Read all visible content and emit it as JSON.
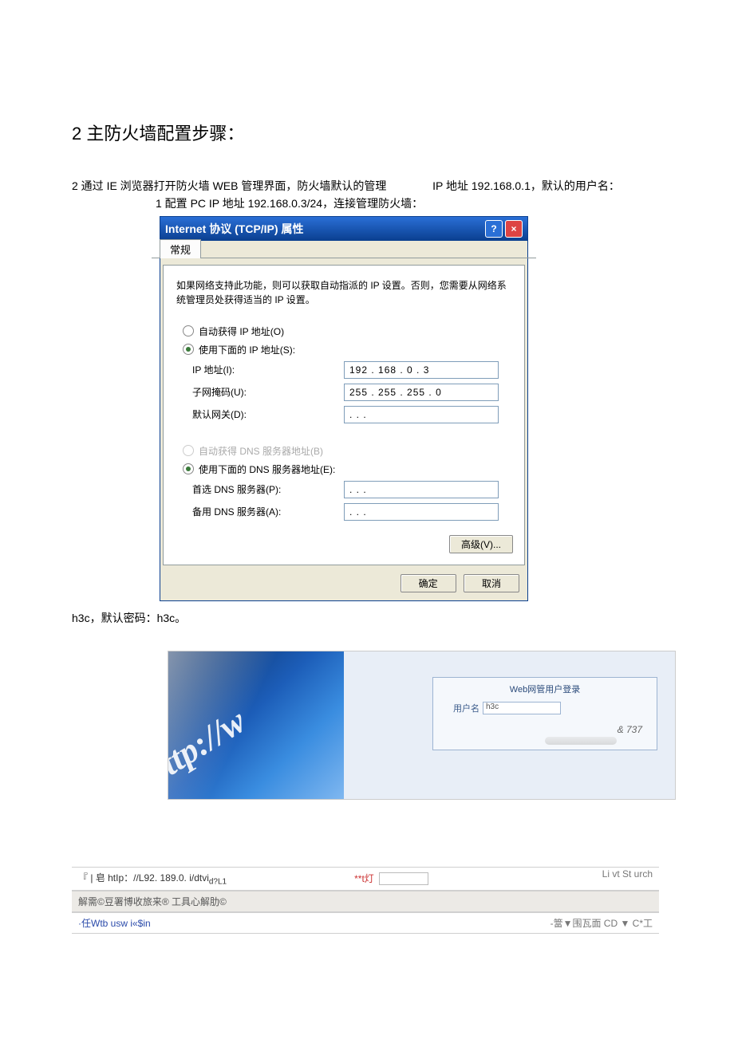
{
  "doc": {
    "heading": "2 主防火墙配置步骤：",
    "para1_left": "2 通过 IE 浏览器打开防火墙 WEB 管理界面，防火墙默认的管理",
    "para1_right": "IP 地址 192.168.0.1，默认的用户名：",
    "para2": "1 配置 PC IP 地址 192.168.0.3/24，连接管理防火墙：",
    "after_dialog": "h3c，默认密码：h3c。"
  },
  "xp": {
    "title": "Internet 协议 (TCP/IP) 属性",
    "tab": "常规",
    "desc": "如果网络支持此功能，则可以获取自动指派的 IP 设置。否则，您需要从网络系统管理员处获得适当的 IP 设置。",
    "radio_auto_ip": "自动获得 IP 地址(O)",
    "radio_manual_ip": "使用下面的 IP 地址(S):",
    "label_ip": "IP 地址(I):",
    "label_mask": "子网掩码(U):",
    "label_gw": "默认网关(D):",
    "radio_auto_dns": "自动获得 DNS 服务器地址(B)",
    "radio_manual_dns": "使用下面的 DNS 服务器地址(E):",
    "label_dns1": "首选 DNS 服务器(P):",
    "label_dns2": "备用 DNS 服务器(A):",
    "ip_value": "192 . 168 .  0  .  3",
    "mask_value": "255 . 255 . 255 .  0",
    "gw_value": " .      .      . ",
    "dns1_value": " .      .      . ",
    "dns2_value": " .      .      . ",
    "btn_adv": "高级(V)...",
    "btn_ok": "确定",
    "btn_cancel": "取消"
  },
  "login": {
    "art_text": "ttp://w",
    "title": "Web网管用户登录",
    "label_user": "用户名",
    "value_user": "h3c",
    "extra": "& 737"
  },
  "strips": {
    "addr_prefix": "『 | 皂  htIp：//L92. 189.0. i/dtvi",
    "addr_suffix": "d?L1",
    "addr_mid_label": "**t灯",
    "addr_right": "Li vt St urch",
    "menu": "解需©豆署博收旅来® 工具心解肋©",
    "link": "·任Wtb usw i«$in",
    "right_text": "-簹▼围瓦面 CD ▼ C*工"
  }
}
